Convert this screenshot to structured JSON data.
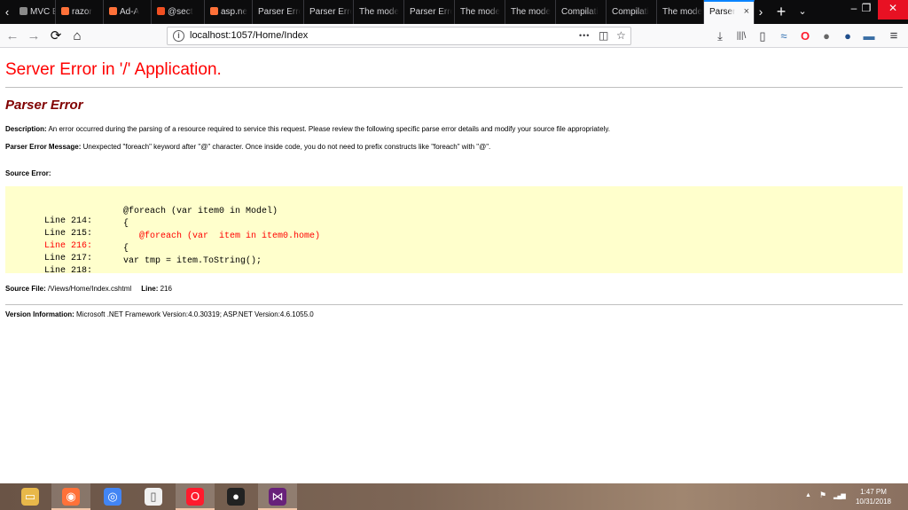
{
  "tabs": [
    {
      "label": "MVC E",
      "fav_color": "#8a8a8a"
    },
    {
      "label": "razor",
      "fav_color": "#ff7139"
    },
    {
      "label": "Ad-A",
      "fav_color": "#ff7139"
    },
    {
      "label": "@sect",
      "fav_color": "#f25022"
    },
    {
      "label": "asp.ne",
      "fav_color": "#ff7139"
    },
    {
      "label": "Parser Erro",
      "fav_color": ""
    },
    {
      "label": "Parser Erro",
      "fav_color": ""
    },
    {
      "label": "The mode",
      "fav_color": ""
    },
    {
      "label": "Parser Erro",
      "fav_color": ""
    },
    {
      "label": "The mode",
      "fav_color": ""
    },
    {
      "label": "The mode",
      "fav_color": ""
    },
    {
      "label": "Compilati",
      "fav_color": ""
    },
    {
      "label": "Compilati",
      "fav_color": ""
    },
    {
      "label": "The mode",
      "fav_color": ""
    },
    {
      "label": "Parser",
      "fav_color": ""
    }
  ],
  "active_tab_index": 14,
  "window": {
    "minimize": "–",
    "maximize": "❐",
    "close": "✕"
  },
  "nav": {
    "back": "←",
    "forward": "→",
    "reload": "⟳",
    "home": "⌂",
    "url": "localhost:1057/Home/Index",
    "page_actions": "•••",
    "pocket": "◫",
    "bookmark": "☆"
  },
  "toolbar_icons": {
    "download": "⤓",
    "library": "|||\\",
    "sidebar": "▯",
    "ext1": "≈",
    "opera": "O",
    "ext2": "●",
    "ext3": "●",
    "ext4": "▬",
    "menu": "≡"
  },
  "error_page": {
    "title": "Server Error in '/' Application.",
    "heading": "Parser Error",
    "description_label": "Description:",
    "description_text": "An error occurred during the parsing of a resource required to service this request. Please review the following specific parse error details and modify your source file appropriately.",
    "message_label": "Parser Error Message:",
    "message_text": "Unexpected \"foreach\" keyword after \"@\" character.  Once inside code, you do not need to prefix constructs like \"foreach\" with \"@\".",
    "source_error_label": "Source Error:",
    "source_lines": [
      {
        "label": "Line 214:",
        "code": "@foreach (var item0 in Model)",
        "error": false
      },
      {
        "label": "Line 215:",
        "code": "{",
        "error": false
      },
      {
        "label": "Line 216:",
        "code": "   @foreach (var  item in item0.home)",
        "error": true
      },
      {
        "label": "Line 217:",
        "code": "{",
        "error": false
      },
      {
        "label": "Line 218:",
        "code": "var tmp = item.ToString();",
        "error": false
      }
    ],
    "source_file_label": "Source File:",
    "source_file_value": "/Views/Home/Index.cshtml",
    "line_label": "Line:",
    "line_value": "216",
    "version_label": "Version Information:",
    "version_text": "Microsoft .NET Framework Version:4.0.30319; ASP.NET Version:4.6.1055.0"
  },
  "taskbar": {
    "apps": [
      {
        "name": "file-explorer",
        "glyph": "▭",
        "color": "#e8b84a",
        "active": false
      },
      {
        "name": "firefox",
        "glyph": "◉",
        "color": "#ff7139",
        "active": true
      },
      {
        "name": "chrome",
        "glyph": "◎",
        "color": "#4285f4",
        "active": false
      },
      {
        "name": "notepad",
        "glyph": "▯",
        "color": "#f0f0f0",
        "active": false
      },
      {
        "name": "opera",
        "glyph": "O",
        "color": "#ff1b2d",
        "active": true
      },
      {
        "name": "github",
        "glyph": "●",
        "color": "#222222",
        "active": false
      },
      {
        "name": "visual-studio",
        "glyph": "⋈",
        "color": "#68217a",
        "active": true
      }
    ],
    "tray": {
      "chevron": "▲",
      "flag": "⚑",
      "signal": "▂▄▆"
    },
    "time": "1:47 PM",
    "date": "10/31/2018"
  }
}
